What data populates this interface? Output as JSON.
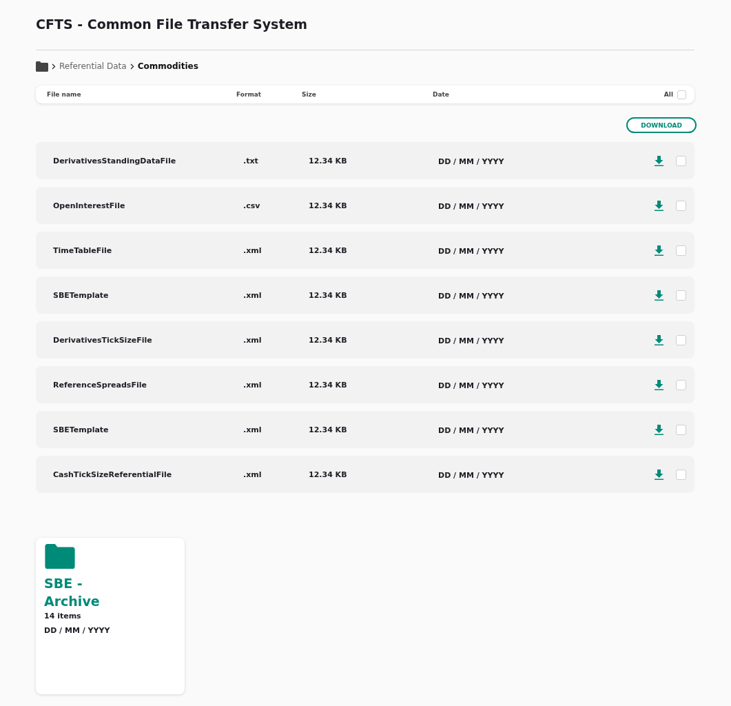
{
  "page": {
    "title": "CFTS - Common File Transfer System"
  },
  "breadcrumb": [
    {
      "label": "Referential Data",
      "current": false
    },
    {
      "label": "Commodities",
      "current": true
    }
  ],
  "table": {
    "columns": [
      "File name",
      "Format",
      "Size",
      "Date"
    ],
    "select_all": {
      "label": "All",
      "checked": false
    },
    "download_button": "DOWNLOAD",
    "rows": [
      {
        "name": "DerivativesStandingDataFile",
        "format": ".txt",
        "size": "12.34 KB",
        "date": "DD / MM / YYYY",
        "checked": false
      },
      {
        "name": "OpenInterestFile",
        "format": ".csv",
        "size": "12.34 KB",
        "date": "DD / MM / YYYY",
        "checked": false
      },
      {
        "name": "TimeTableFile",
        "format": ".xml",
        "size": "12.34 KB",
        "date": "DD / MM / YYYY",
        "checked": false
      },
      {
        "name": "SBETemplate",
        "format": ".xml",
        "size": "12.34 KB",
        "date": "DD / MM / YYYY",
        "checked": false
      },
      {
        "name": "DerivativesTickSizeFile",
        "format": ".xml",
        "size": "12.34 KB",
        "date": "DD / MM / YYYY",
        "checked": false
      },
      {
        "name": "ReferenceSpreadsFile",
        "format": ".xml",
        "size": "12.34 KB",
        "date": "DD / MM / YYYY",
        "checked": false
      },
      {
        "name": "SBETemplate",
        "format": ".xml",
        "size": "12.34 KB",
        "date": "DD / MM / YYYY",
        "checked": false
      },
      {
        "name": "CashTickSizeReferentialFile",
        "format": ".xml",
        "size": "12.34 KB",
        "date": "DD / MM / YYYY",
        "checked": false
      }
    ]
  },
  "folders": [
    {
      "title": "SBE - Archive",
      "count": "14 items",
      "date": "DD / MM / YYYY"
    }
  ]
}
